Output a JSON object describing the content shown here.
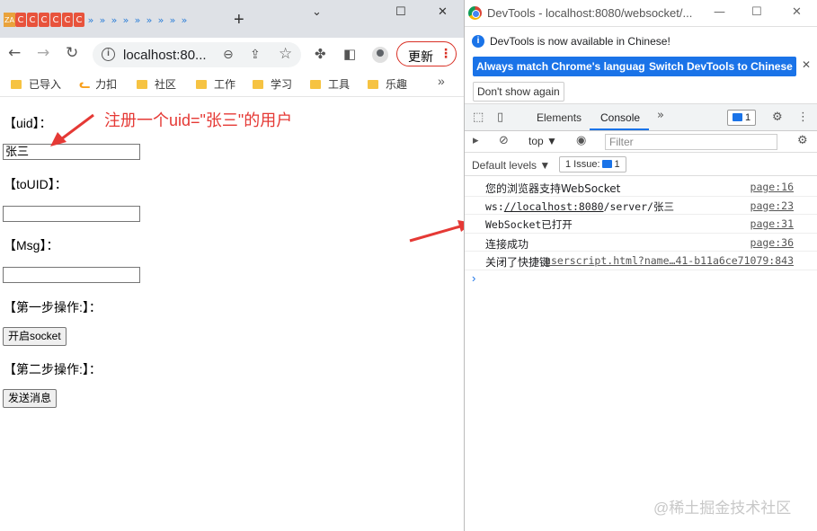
{
  "browser": {
    "tab_icons": [
      "ZA",
      "C",
      "C",
      "C",
      "C",
      "C",
      "C",
      "»",
      "»",
      "»",
      "»",
      "»",
      "»",
      "»",
      "»",
      "»"
    ],
    "new_tab": "+",
    "window_controls": {
      "minimize": "⌄",
      "maximize": "☐",
      "close": "✕"
    },
    "address": "localhost:80...",
    "update_label": "更新",
    "bookmarks": [
      "已导入",
      "力扣",
      "社区",
      "工作",
      "学习",
      "工具",
      "乐趣"
    ],
    "bookmarks_more": "»"
  },
  "form": {
    "uid_label": "【uid】：",
    "uid_value": "张三",
    "touid_label": "【toUID】：",
    "touid_value": "",
    "msg_label": "【Msg】：",
    "msg_value": "",
    "step1_label": "【第一步操作:】：",
    "open_socket_button": "开启socket",
    "step2_label": "【第二步操作:】：",
    "send_button": "发送消息"
  },
  "annotation": "注册一个uid=\"张三\"的用户",
  "devtools": {
    "title": "DevTools - localhost:8080/websocket/...",
    "info_message": "DevTools is now available in Chinese!",
    "btn_match": "Always match Chrome's language",
    "btn_switch": "Switch DevTools to Chinese",
    "btn_dont_show": "Don't show again",
    "tabs": [
      "Elements",
      "Console"
    ],
    "active_tab": "Console",
    "more_tabs": "»",
    "issues_badge": "1",
    "context": "top",
    "filter_placeholder": "Filter",
    "levels": "Default levels ▼",
    "issue_count": "1 Issue:",
    "issue_count_num": "1",
    "console_rows": [
      {
        "msg": "您的浏览器支持WebSocket",
        "src": "page:16"
      },
      {
        "msg_prefix": "ws:",
        "msg_link": "//localhost:8080",
        "msg_suffix": "/server/张三",
        "src": "page:23"
      },
      {
        "msg": "WebSocket已打开",
        "src": "page:31"
      },
      {
        "msg": "连接成功",
        "src": "page:36"
      },
      {
        "msg": "关闭了快捷键",
        "src": "userscript.html?name…41-b11a6ce71079:843"
      }
    ],
    "prompt": "›"
  },
  "watermark": "@稀土掘金技术社区",
  "colors": {
    "accent": "#1a73e8",
    "annotation_red": "#e53935",
    "update_red": "#d93025"
  }
}
